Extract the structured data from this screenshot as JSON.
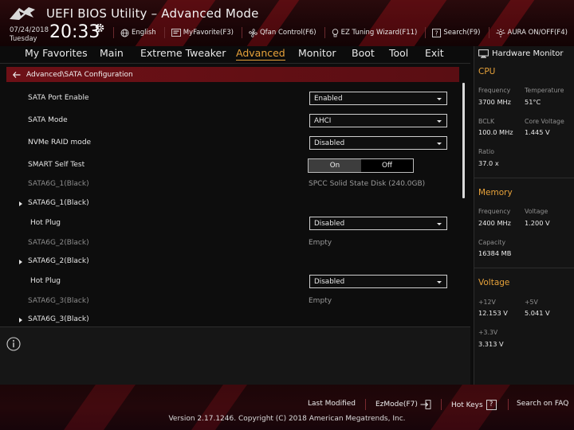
{
  "header": {
    "title": "UEFI BIOS Utility – Advanced Mode",
    "date": "07/24/2018",
    "day": "Tuesday",
    "time": "20:33",
    "toolbar": [
      {
        "label": "English",
        "icon": "globe-icon"
      },
      {
        "label": "MyFavorite(F3)",
        "icon": "favorite-icon"
      },
      {
        "label": "Qfan Control(F6)",
        "icon": "fan-icon"
      },
      {
        "label": "EZ Tuning Wizard(F11)",
        "icon": "bulb-icon"
      },
      {
        "label": "Search(F9)",
        "icon": "search-icon"
      },
      {
        "label": "AURA ON/OFF(F4)",
        "icon": "aura-icon"
      }
    ]
  },
  "tabs": [
    "My Favorites",
    "Main",
    "Extreme Tweaker",
    "Advanced",
    "Monitor",
    "Boot",
    "Tool",
    "Exit"
  ],
  "active_tab": "Advanced",
  "breadcrumb": "Advanced\\SATA Configuration",
  "settings": [
    {
      "label": "SATA Port Enable",
      "type": "select",
      "value": "Enabled"
    },
    {
      "label": "SATA Mode",
      "type": "select",
      "value": "AHCI"
    },
    {
      "label": "NVMe RAID mode",
      "type": "select",
      "value": "Disabled"
    },
    {
      "label": "SMART Self Test",
      "type": "toggle",
      "on_label": "On",
      "off_label": "Off",
      "value": "On"
    },
    {
      "label": "SATA6G_1(Black)",
      "type": "info",
      "value": "SPCC Solid State Disk (240.0GB)"
    },
    {
      "label": "SATA6G_1(Black)",
      "type": "submenu"
    },
    {
      "label": "Hot Plug",
      "type": "select",
      "value": "Disabled"
    },
    {
      "label": "SATA6G_2(Black)",
      "type": "info",
      "value": "Empty"
    },
    {
      "label": "SATA6G_2(Black)",
      "type": "submenu"
    },
    {
      "label": "Hot Plug",
      "type": "select",
      "value": "Disabled"
    },
    {
      "label": "SATA6G_3(Black)",
      "type": "info",
      "value": "Empty"
    },
    {
      "label": "SATA6G_3(Black)",
      "type": "submenu"
    }
  ],
  "hardware_monitor": {
    "title": "Hardware Monitor",
    "cpu": {
      "title": "CPU",
      "frequency_label": "Frequency",
      "frequency": "3700 MHz",
      "temperature_label": "Temperature",
      "temperature": "51°C",
      "bclk_label": "BCLK",
      "bclk": "100.0 MHz",
      "core_voltage_label": "Core Voltage",
      "core_voltage": "1.445 V",
      "ratio_label": "Ratio",
      "ratio": "37.0 x"
    },
    "memory": {
      "title": "Memory",
      "frequency_label": "Frequency",
      "frequency": "2400 MHz",
      "voltage_label": "Voltage",
      "voltage": "1.200 V",
      "capacity_label": "Capacity",
      "capacity": "16384 MB"
    },
    "voltage": {
      "title": "Voltage",
      "v12_label": "+12V",
      "v12": "12.153 V",
      "v5_label": "+5V",
      "v5": "5.041 V",
      "v33_label": "+3.3V",
      "v33": "3.313 V"
    }
  },
  "footer": {
    "last_modified": "Last Modified",
    "ezmode": "EzMode(F7)",
    "hotkeys": "Hot Keys",
    "hotkeys_key": "?",
    "search_faq": "Search on FAQ",
    "copyright": "Version 2.17.1246. Copyright (C) 2018 American Megatrends, Inc."
  },
  "colors": {
    "accent": "#e7a23a",
    "brand_red": "#6d1016"
  }
}
